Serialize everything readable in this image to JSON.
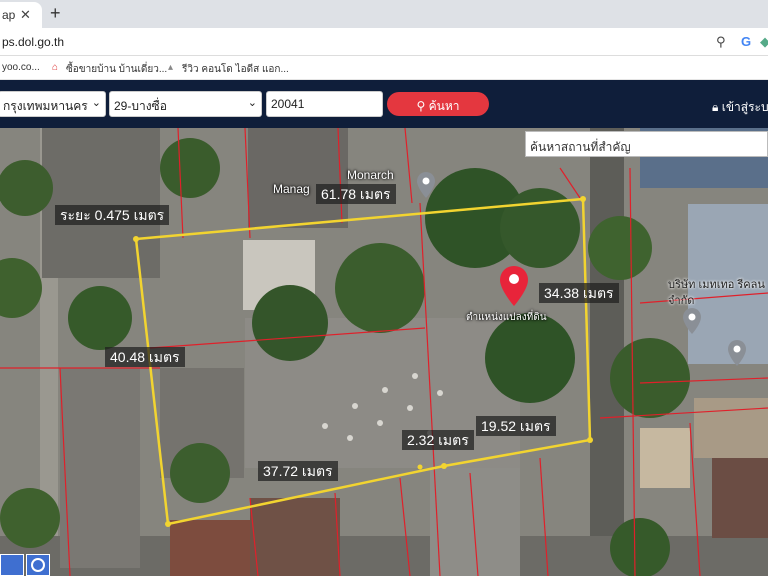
{
  "browser": {
    "tab_title": "ap",
    "url": "ps.dol.go.th",
    "bookmarks": [
      "yoo.co...",
      "ซื้อขายบ้าน บ้านเดี่ยว...",
      "รีวิว คอนโด ไอดีส แอก..."
    ]
  },
  "toolbar": {
    "province": "กรุงเทพมหานคร",
    "district": "29-บางซื่อ",
    "parcel_no": "20041",
    "search_label": "ค้นหา",
    "login_label": "เข้าสู่ระบ"
  },
  "map": {
    "place_search_placeholder": "ค้นหาสถานที่สำคัญ",
    "measurements": [
      "61.78 เมตร",
      "34.38 เมตร",
      "40.48 เมตร",
      "19.52 เมตร",
      "2.32 เมตร",
      "37.72 เมตร",
      "ระยะ 0.475 เมตร"
    ],
    "labels": {
      "monarch": "Monarch",
      "manag": "Manag",
      "parcel_pin": "ตำแหน่งแปลงที่ดิน",
      "company": "บริษัท เมทเทอ รีคลน จำกัด"
    },
    "colors": {
      "boundary": "#f2d430",
      "parcel_lines": "#e0202a",
      "pin": "#e8243a"
    }
  }
}
